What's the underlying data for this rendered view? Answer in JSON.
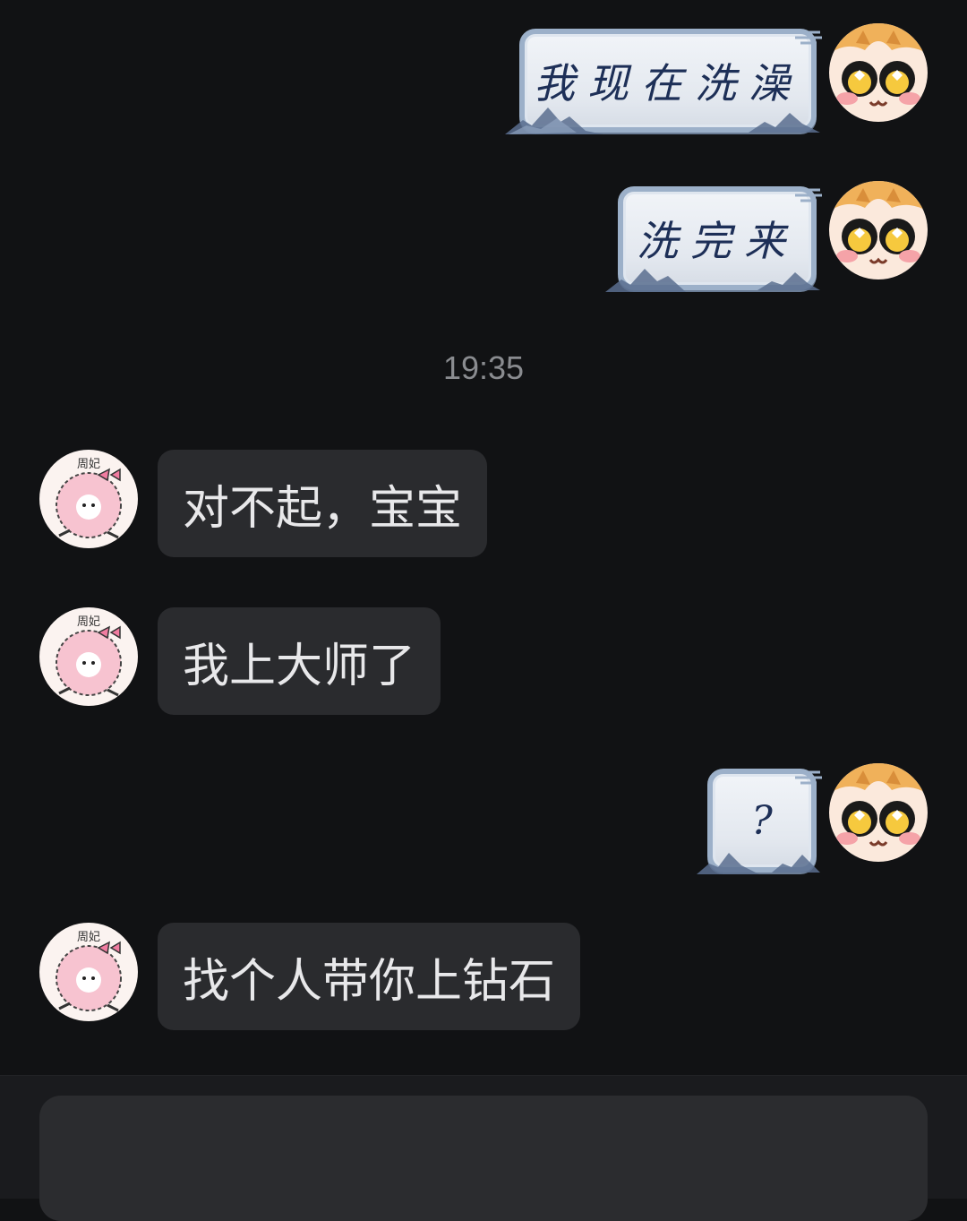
{
  "conversation": {
    "messages": [
      {
        "side": "sent",
        "text": "我现在洗澡",
        "avatar": "cartoon-girl-avatar"
      },
      {
        "side": "sent",
        "text": "洗完来",
        "avatar": "cartoon-girl-avatar"
      },
      {
        "side": "time",
        "text": "19:35"
      },
      {
        "side": "received",
        "text": "对不起，宝宝",
        "avatar": "pink-sheep-avatar"
      },
      {
        "side": "received",
        "text": "我上大师了",
        "avatar": "pink-sheep-avatar"
      },
      {
        "side": "sent",
        "text": "?",
        "avatar": "cartoon-girl-avatar"
      },
      {
        "side": "received",
        "text": "找个人带你上钻石",
        "avatar": "pink-sheep-avatar"
      }
    ],
    "contact_avatar_label": "周妃"
  },
  "input": {
    "value": "",
    "placeholder": ""
  },
  "colors": {
    "background": "#111214",
    "received_bubble": "#2a2b2e",
    "sent_bubble_border": "#9cb0c9",
    "sent_text": "#1d2f57"
  }
}
